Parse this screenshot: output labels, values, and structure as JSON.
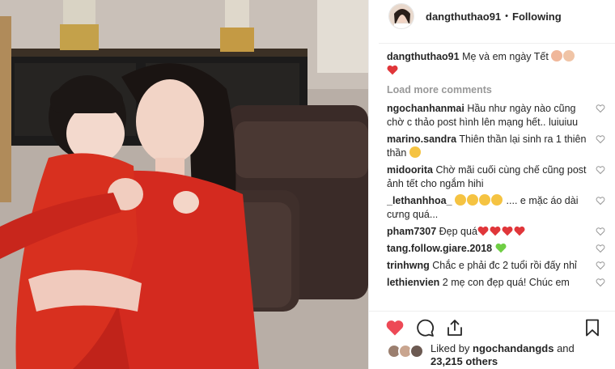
{
  "post": {
    "username": "dangthuthao91",
    "separator": "•",
    "follow_label": "Following"
  },
  "caption": {
    "username": "dangthuthao91",
    "text": "Mẹ và em ngày Tết"
  },
  "load_more": "Load more comments",
  "comments": [
    {
      "username": "ngochanhanmai",
      "text": "Hầu như ngày nào cũng chờ c thảo post hình lên mạng hết.. luiuiuu"
    },
    {
      "username": "marino.sandra",
      "text": "Thiên thần lại sinh ra 1 thiên thần"
    },
    {
      "username": "midoorita",
      "text": "Chờ mãi cuối cùng chế cũng post ảnh tết cho ngắm hihi"
    },
    {
      "username": "_lethanhhoa_",
      "text_after": ".... e mặc áo dài cưng quá..."
    },
    {
      "username": "pham7307",
      "text": "Đẹp quá"
    },
    {
      "username": "tang.follow.giare.2018",
      "text": ""
    },
    {
      "username": "trinhwng",
      "text": "Chắc e phải đc 2 tuổi rồi đấy nhỉ"
    },
    {
      "username": "lethienvien",
      "text": "2 mẹ con đẹp quá! Chúc em"
    }
  ],
  "likes": {
    "prefix": "Liked by",
    "user": "ngochandangds",
    "and": "and",
    "count": "23,215 others"
  },
  "icons": [
    "heart-icon",
    "comment-icon",
    "share-icon",
    "bookmark-icon"
  ],
  "colors": {
    "heart": "#ed4956",
    "text": "#262626",
    "muted": "#999999",
    "dress": "#d42a1f"
  }
}
